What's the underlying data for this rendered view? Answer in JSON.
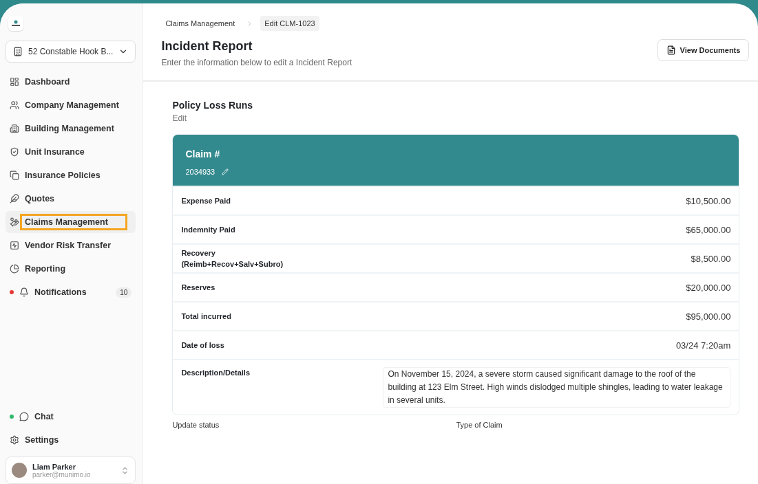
{
  "sidebar": {
    "building": "52 Constable Hook B...",
    "items": [
      {
        "label": "Dashboard",
        "selected": false
      },
      {
        "label": "Company Management",
        "selected": false
      },
      {
        "label": "Building Management",
        "selected": false
      },
      {
        "label": "Unit Insurance",
        "selected": false
      },
      {
        "label": "Insurance Policies",
        "selected": false
      },
      {
        "label": "Quotes",
        "selected": false
      },
      {
        "label": "Claims Management",
        "selected": true
      },
      {
        "label": "Vendor Risk Transfer",
        "selected": false
      },
      {
        "label": "Reporting",
        "selected": false
      },
      {
        "label": "Notifications",
        "selected": false,
        "color": "#e53935",
        "badge": "10"
      }
    ],
    "bottom_items": [
      {
        "label": "Chat",
        "selected": false,
        "color": "#2fb86b"
      },
      {
        "label": "Settings",
        "selected": false
      }
    ],
    "user": {
      "name": "Liam Parker",
      "email": "parker@munimo.io"
    }
  },
  "breadcrumbs": [
    "Claims Management",
    "Edit CLM-1023"
  ],
  "header": {
    "title": "Incident Report",
    "subtitle": "Enter the information below to edit a Incident Report",
    "button": "View Documents"
  },
  "section": {
    "title": "Policy Loss Runs",
    "subtitle": "Edit"
  },
  "claim": {
    "label": "Claim #",
    "number": "2034933",
    "rows": [
      {
        "label": "Expense Paid",
        "value": "$10,500.00"
      },
      {
        "label": "Indemnity Paid",
        "value": "$65,000.00"
      },
      {
        "label": "Recovery",
        "sublabel": "(Reimb+Recov+Salv+Subro)",
        "value": "$8,500.00"
      },
      {
        "label": "Reserves",
        "value": "$20,000.00"
      },
      {
        "label": "Total incurred",
        "value": "$95,000.00"
      },
      {
        "label": "Date of loss",
        "value": "03/24 7:20am"
      }
    ],
    "description": {
      "label": "Description/Details",
      "value": "On November 15, 2024, a severe storm caused significant damage to the roof of the building at 123 Elm Street. High winds dislodged multiple shingles, leading to water leakage in several units."
    }
  },
  "fields": [
    "Update status",
    "Type of Claim"
  ]
}
